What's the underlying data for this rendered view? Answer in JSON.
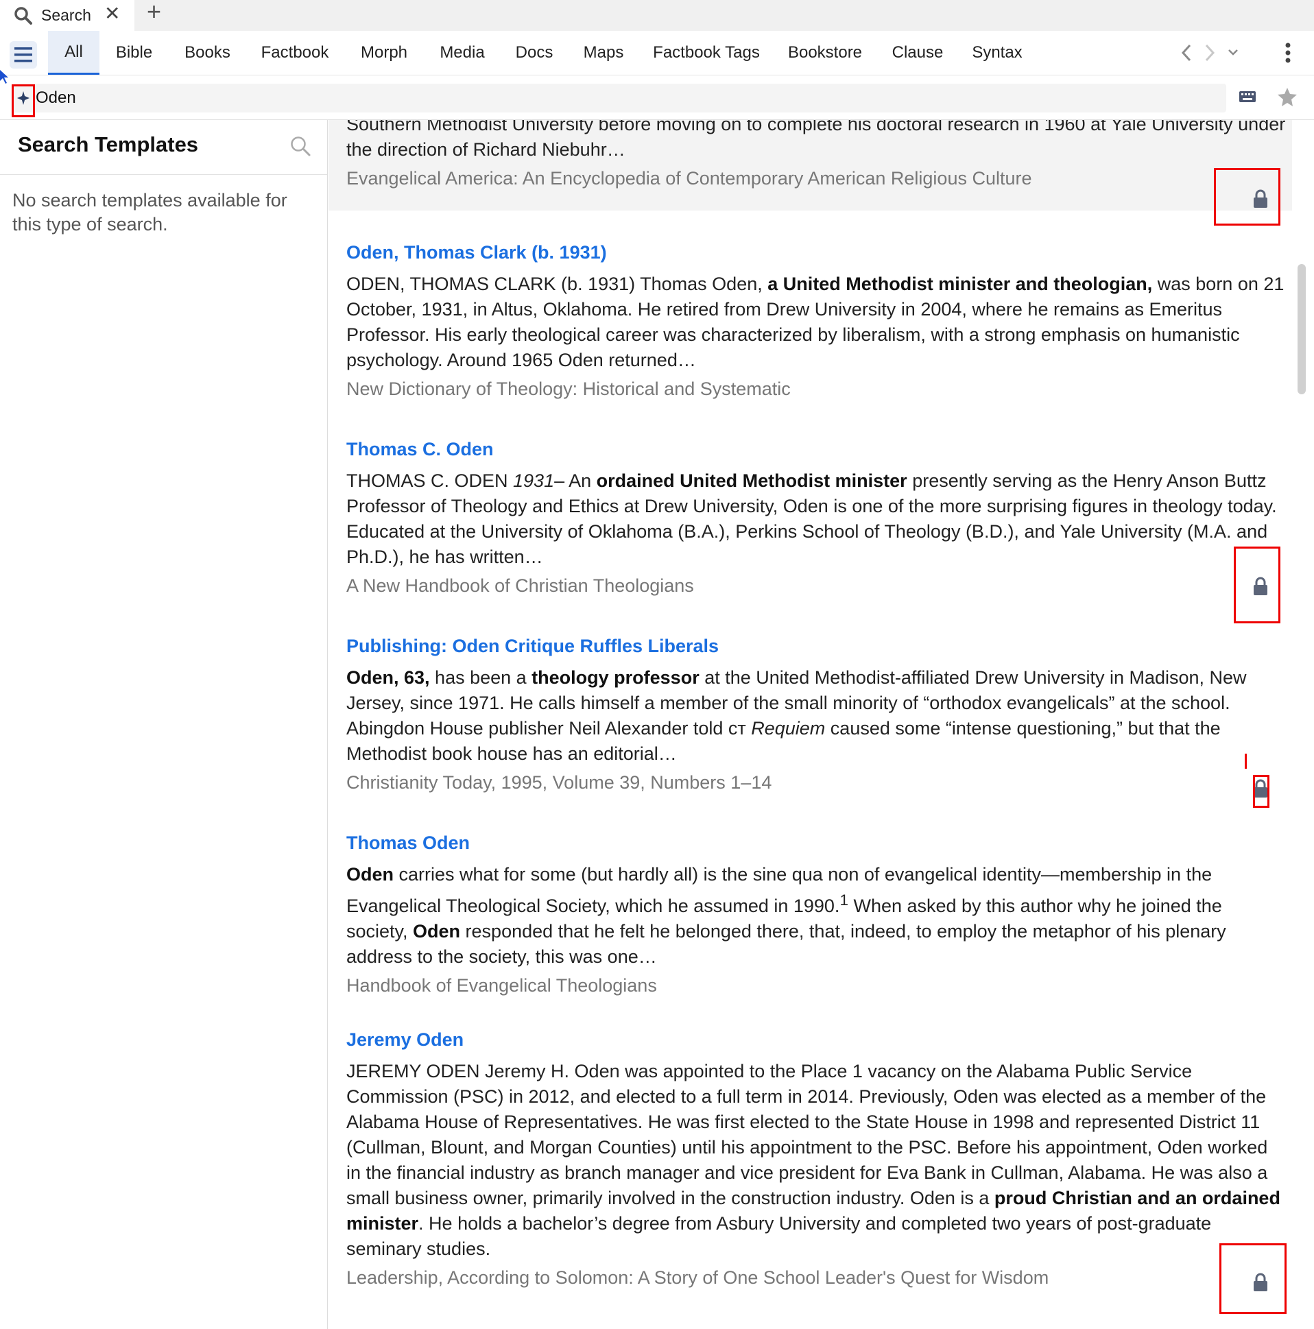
{
  "tab": {
    "title": "Search",
    "close": "✕",
    "new": "+"
  },
  "nav": {
    "tabs": [
      "All",
      "Bible",
      "Books",
      "Factbook",
      "Morph",
      "Media",
      "Docs",
      "Maps",
      "Factbook Tags",
      "Bookstore",
      "Clause",
      "Syntax"
    ],
    "active": "All"
  },
  "search": {
    "value": "Oden"
  },
  "sidebar": {
    "title": "Search Templates",
    "message": "No search templates available for this type of search."
  },
  "results": [
    {
      "title": "",
      "snippet_html": "Southern Methodist University before moving on to complete his doctoral research in 1960 at Yale University under the direction of Richard Niebuhr…",
      "source": "Evangelical America: An Encyclopedia of Contemporary American Religious Culture",
      "locked": true
    },
    {
      "title": "Oden, Thomas Clark (b. 1931)",
      "snippet_html": "ODEN, THOMAS CLARK (b. 1931) Thomas Oden, <b>a United Methodist minister and theologian,</b> was born on 21 October, 1931, in Altus, Oklahoma. He retired from Drew University in 2004, where he remains as Emeritus Professor. His early theological career was characterized by liberalism, with a strong emphasis on humanistic psychology. Around 1965 Oden returned…",
      "source": "New Dictionary of Theology: Historical and Systematic",
      "locked": false
    },
    {
      "title": "Thomas C. Oden",
      "snippet_html": "THOMAS C. ODEN <i>1931</i>– An <b>ordained United Methodist minister</b> presently serving as the Henry Anson Buttz Professor of Theology and Ethics at Drew University, Oden is one of the more surprising figures in theology today. Educated at the University of Oklahoma (B.A.), Perkins School of Theology (B.D.), and Yale University (M.A. and Ph.D.), he has written…",
      "source": "A New Handbook of Christian Theologians",
      "locked": true
    },
    {
      "title": "Publishing: Oden Critique Ruffles Liberals",
      "snippet_html": "<b>Oden, 63,</b> has been a <b>theology professor</b> at the United Methodist-affiliated Drew University in Madison, New Jersey, since 1971. He calls himself a member of the small minority of “orthodox evangelicals” at the school. Abingdon House publisher Neil Alexander told ᴄᴛ <i>Requiem</i> caused some “intense questioning,” but that the Methodist book house has an editorial…",
      "source": "Christianity Today, 1995, Volume 39, Numbers 1–14",
      "locked": true
    },
    {
      "title": "Thomas Oden",
      "snippet_html": "<b>Oden</b> carries what for some (but hardly all) is the sine qua non of evangelical identity—membership in the Evangelical Theological Society, which he assumed in 1990.<sup>1</sup> When asked by this author why he joined the society, <b>Oden</b> responded that he felt he belonged there, that, indeed, to employ the metaphor of his plenary address to the society, this was one…",
      "source": "Handbook of Evangelical Theologians",
      "locked": false
    },
    {
      "title": "Jeremy Oden",
      "snippet_html": "JEREMY ODEN Jeremy H. Oden was appointed to the Place 1 vacancy on the Alabama Public Service Commission (PSC) in 2012, and elected to a full term in 2014. Previously, Oden was elected as a member of the Alabama House of Representatives. He was first elected to the State House in 1998 and represented District 11 (Cullman, Blount, and Morgan Counties) until his appointment to the PSC. Before his appointment, Oden worked in the financial industry as branch manager and vice president for Eva Bank in Cullman, Alabama. He was also a small business owner, primarily involved in the construction industry. Oden is a <b>proud Christian and an ordained minister</b>. He holds a bachelor’s degree from Asbury University and completed two years of post-graduate seminary studies.",
      "source": "Leadership, According to Solomon: A Story of One School Leader's Quest for Wisdom",
      "locked": true
    }
  ],
  "colors": {
    "link": "#1b6fe0",
    "accent": "#1b64d8",
    "lock": "#5b6478",
    "highlight": "#e00000"
  }
}
